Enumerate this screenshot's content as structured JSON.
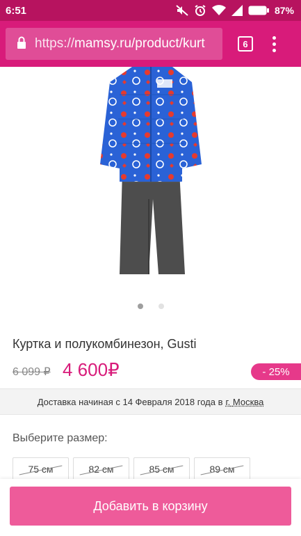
{
  "status_bar": {
    "time": "6:51",
    "battery_percent": "87%",
    "icons": [
      "mute-icon",
      "alarm-icon",
      "wifi-icon",
      "signal-icon",
      "battery-icon"
    ]
  },
  "browser": {
    "url_scheme": "https://",
    "url_rest": "mamsy.ru/product/kurt",
    "tab_count": "6"
  },
  "product": {
    "title": "Куртка и полукомбинезон, Gusti",
    "old_price": "6 099 ₽",
    "new_price": "4 600₽",
    "discount": "- 25%",
    "image_count": 2,
    "active_image": 0
  },
  "delivery": {
    "text": "Доставка начиная с 14 Февраля 2018 года в",
    "city_prefix": "г.",
    "city": "Москва"
  },
  "sizes": {
    "label": "Выберите размер:",
    "options": [
      {
        "label": "75 см",
        "available": false
      },
      {
        "label": "82 см",
        "available": false
      },
      {
        "label": "85 см",
        "available": false
      },
      {
        "label": "89 см",
        "available": false
      }
    ]
  },
  "cart": {
    "add_label": "Добавить в корзину"
  },
  "colors": {
    "status_bar": "#b7135f",
    "toolbar": "#d81b7a",
    "price": "#d81b7a",
    "badge": "#e6398a",
    "button": "#ee5b9a",
    "jacket": "#2a62d6",
    "pants": "#4d4d4d"
  }
}
